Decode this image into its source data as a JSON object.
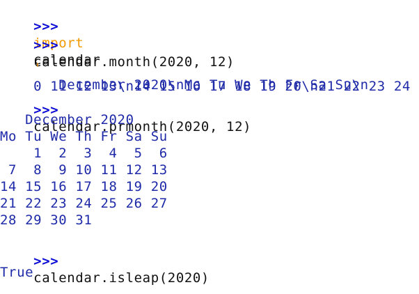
{
  "session": {
    "line1": {
      "prompt": ">>>",
      "keyword": "import",
      "text": "calendar"
    },
    "line2": {
      "prompt": ">>>",
      "text": "calendar.month(2020, 12)"
    },
    "month_output": {
      "quote": "'",
      "line1": "   December 2020\\nMo Tu We Th Fr Sa Su\\n",
      "line2": "0 11 12 13\\n14 15 16 17 18 19 20\\n21 22 23 24"
    },
    "line3": {
      "prompt": ">>>",
      "text": "calendar.prmonth(2020, 12)"
    },
    "prmonth_output": [
      "   December 2020",
      "Mo Tu We Th Fr Sa Su",
      "    1  2  3  4  5  6",
      " 7  8  9 10 11 12 13",
      "14 15 16 17 18 19 20",
      "21 22 23 24 25 26 27",
      "28 29 30 31"
    ],
    "line4": {
      "prompt": ">>>",
      "text": "calendar.isleap(2020)"
    },
    "result": "True"
  },
  "colors": {
    "prompt": "#0b0bd6",
    "keyword": "#f29900",
    "output": "#1f2aa8",
    "text": "#111111",
    "background": "#ffffff"
  }
}
